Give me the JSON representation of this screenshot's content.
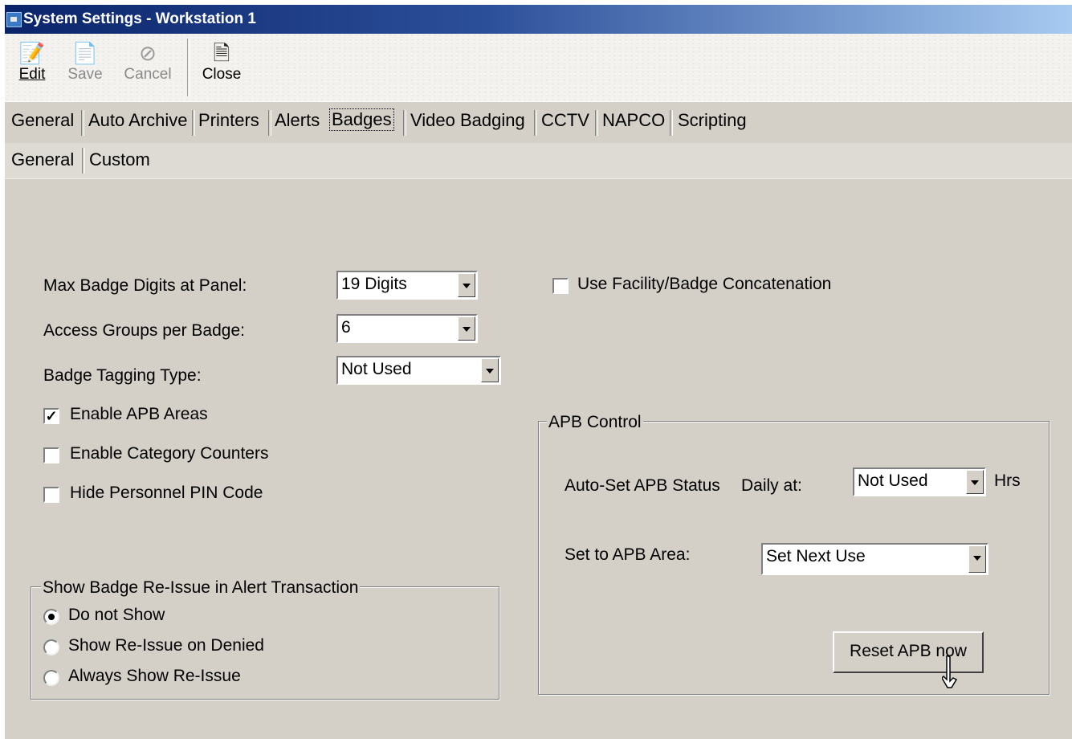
{
  "window": {
    "title": "System Settings - Workstation 1"
  },
  "toolbar": {
    "edit_label": "Edit",
    "save_label": "Save",
    "cancel_label": "Cancel",
    "close_label": "Close"
  },
  "tabs": {
    "general": "General",
    "auto_archive": "Auto Archive",
    "printers": "Printers",
    "alerts": "Alerts",
    "badges": "Badges",
    "video_badging": "Video Badging",
    "cctv": "CCTV",
    "napco": "NAPCO",
    "scripting": "Scripting",
    "selected": "Badges"
  },
  "subtabs": {
    "general": "General",
    "custom": "Custom",
    "selected": "General"
  },
  "form": {
    "max_badge_digits_label": "Max Badge Digits at Panel:",
    "max_badge_digits_value": "19 Digits",
    "access_groups_label": "Access Groups per Badge:",
    "access_groups_value": "6",
    "badge_tagging_label": "Badge Tagging Type:",
    "badge_tagging_value": "Not Used",
    "enable_apb_label": "Enable APB Areas",
    "enable_apb_checked": true,
    "enable_category_label": "Enable Category Counters",
    "enable_category_checked": false,
    "hide_pin_label": "Hide Personnel PIN Code",
    "hide_pin_checked": false,
    "use_concat_label": "Use Facility/Badge Concatenation",
    "use_concat_checked": false
  },
  "reissue_group": {
    "title": "Show Badge Re-Issue in Alert Transaction",
    "options": [
      "Do not Show",
      "Show Re-Issue on Denied",
      "Always Show Re-Issue"
    ],
    "selected": "Do not Show"
  },
  "apb_control": {
    "title": "APB Control",
    "auto_set_label": "Auto-Set APB Status",
    "daily_at_label": "Daily at:",
    "daily_at_value": "Not Used",
    "hrs_label": "Hrs",
    "set_area_label": "Set to APB Area:",
    "set_area_value": "Set Next Use",
    "reset_button_label": "Reset APB now"
  }
}
